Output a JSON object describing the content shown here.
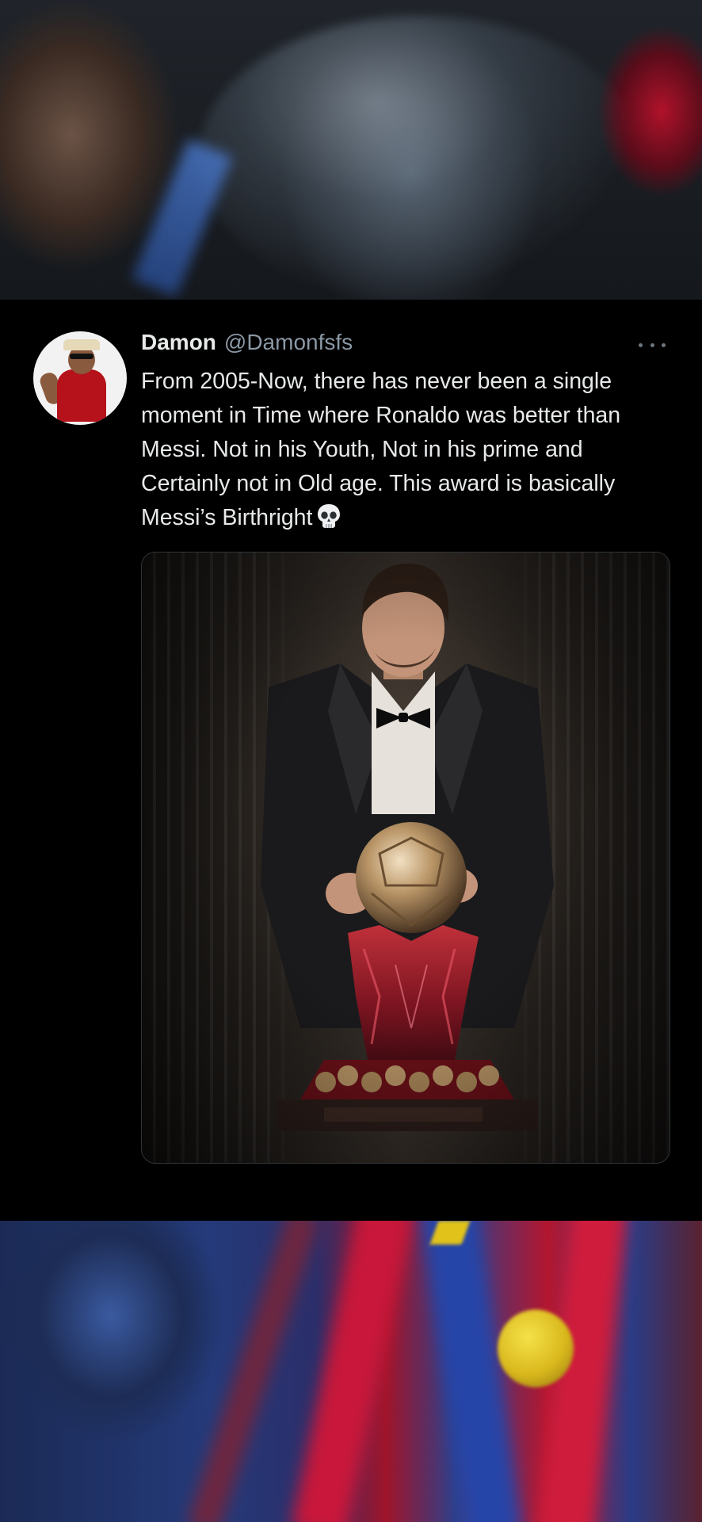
{
  "tweet": {
    "display_name": "Damon",
    "handle": "@Damonfsfs",
    "text": "From 2005-Now, there has never been a single moment in Time where Ronaldo was better than Messi. Not in his Youth, Not in his prime and Certainly not in Old age. This award is basically Messi’s Birthright",
    "emoji": "skull-icon",
    "more_icon": "more-options-icon"
  },
  "colors": {
    "background": "#000000",
    "text_primary": "#e7e9ea",
    "text_secondary": "#8b98a5"
  }
}
